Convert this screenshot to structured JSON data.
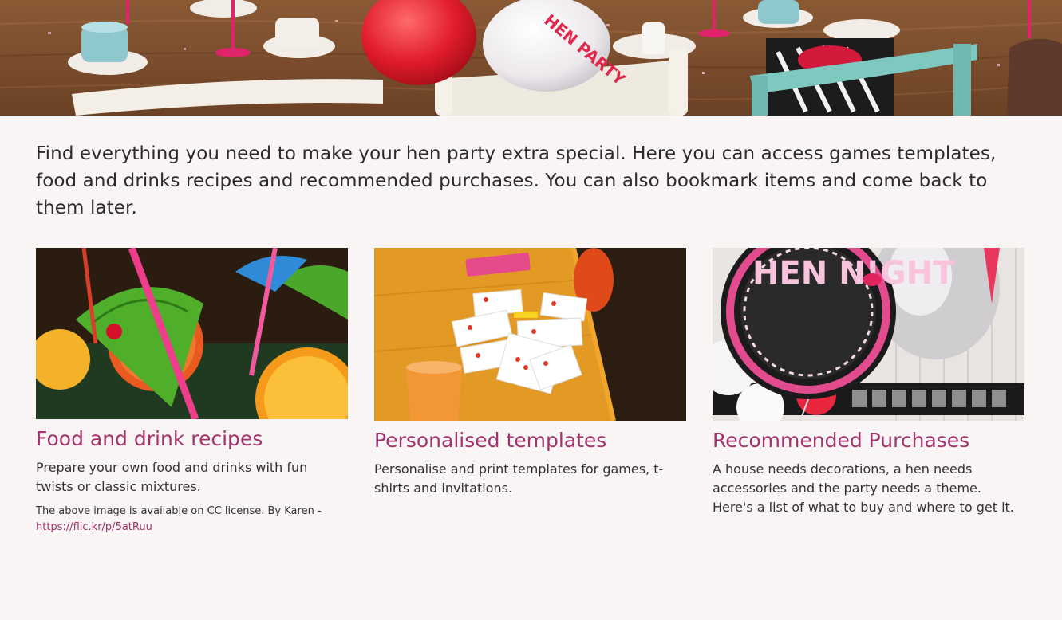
{
  "intro": {
    "text": "Find everything you need to make your hen party extra special. Here you can access games templates, food and drinks recipes and recommended purchases. You can also bookmark items and come back to them later."
  },
  "hero": {
    "balloon_text": "HEN PARTY"
  },
  "cards": [
    {
      "title": "Food and drink recipes",
      "description": "Prepare your own food and drinks with fun twists or classic mixtures.",
      "credit_text": "The above image is available on CC license. By Karen -",
      "credit_link": "https://flic.kr/p/5atRuu"
    },
    {
      "title": "Personalised templates",
      "description": "Personalise and print templates for games, t-shirts and invitations."
    },
    {
      "title": "Recommended Purchases",
      "description": "A house needs decorations, a hen needs accessories and the party needs a theme. Here's a list of what to buy and where to get it.",
      "balloon_text": "HEN N!GHT"
    }
  ],
  "colors": {
    "accent": "#a3336e",
    "background": "#f9f5f4",
    "text": "#2d2d2d"
  }
}
